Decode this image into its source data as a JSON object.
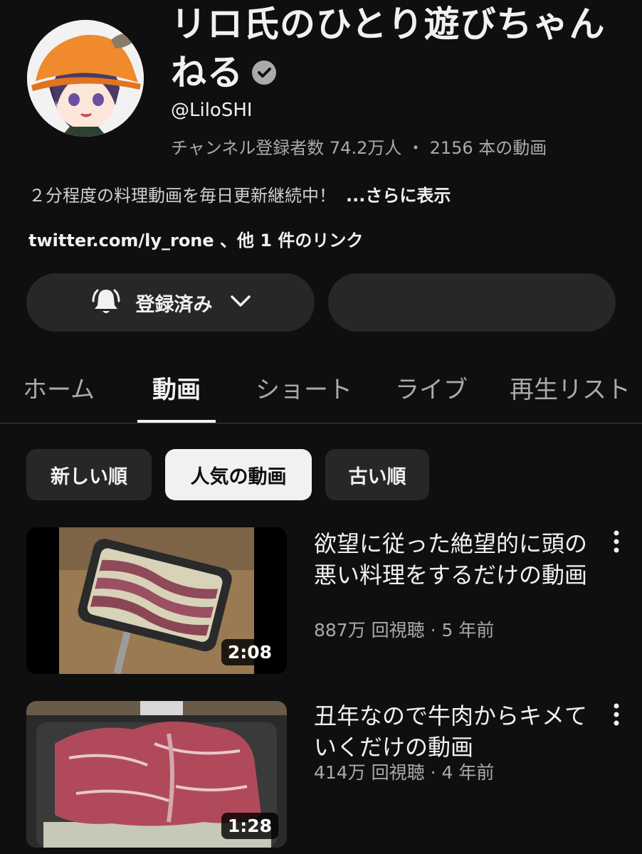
{
  "channel": {
    "title": "リロ氏のひとり遊びちゃんねる",
    "handle": "@LiloSHI",
    "stats": "チャンネル登録者数 74.2万人 ・ 2156 本の動画",
    "description": "２分程度の料理動画を毎日更新継続中！",
    "more_label": "...さらに表示",
    "links": "twitter.com/ly_rone 、他 1 件のリンク"
  },
  "subscribe": {
    "label": "登録済み",
    "icon": "bell-icon"
  },
  "tabs": [
    {
      "label": "ホーム",
      "active": false
    },
    {
      "label": "動画",
      "active": true
    },
    {
      "label": "ショート",
      "active": false
    },
    {
      "label": "ライブ",
      "active": false
    },
    {
      "label": "再生リスト",
      "active": false
    }
  ],
  "chips": [
    {
      "label": "新しい順",
      "active": false
    },
    {
      "label": "人気の動画",
      "active": true
    },
    {
      "label": "古い順",
      "active": false
    }
  ],
  "videos": [
    {
      "title": "欲望に従った絶望的に頭の悪い料理をするだけの動画",
      "meta": "887万 回視聴 · 5 年前",
      "duration": "2:08"
    },
    {
      "title": "丑年なので牛肉からキメていくだけの動画",
      "meta": "414万 回視聴 · 4 年前",
      "duration": "1:28"
    }
  ],
  "colors": {
    "background": "#0f0f0f",
    "surface": "#272727",
    "text": "#f1f1f1",
    "secondary_text": "#aaaaaa"
  }
}
